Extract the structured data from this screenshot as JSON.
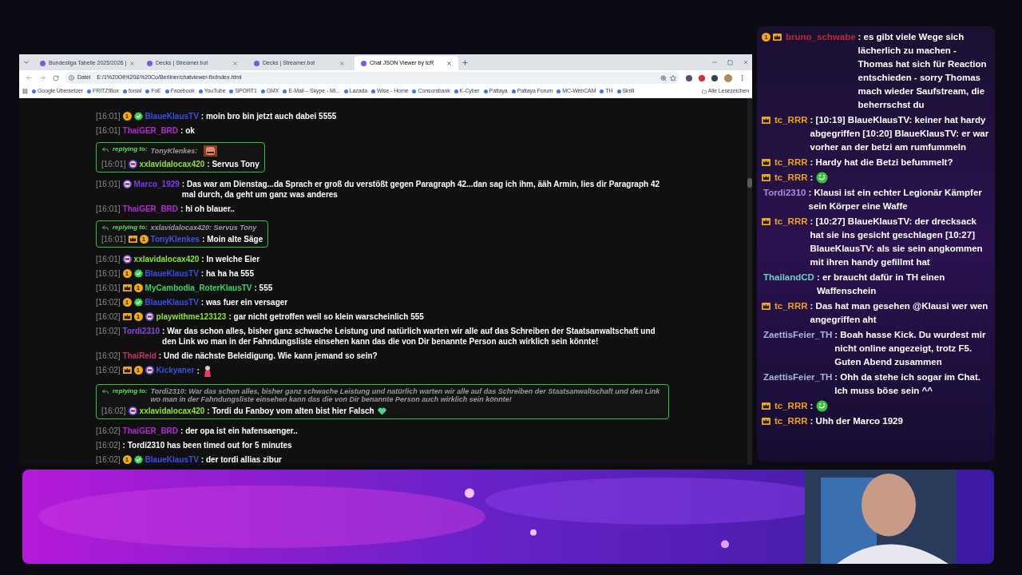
{
  "browser": {
    "tabs": [
      {
        "title": "Bundesliga Tabelle 2025/2026 |",
        "selected": false
      },
      {
        "title": "Decks | Streamer.bot",
        "selected": false
      },
      {
        "title": "Decks | Streamer.bot",
        "selected": false
      },
      {
        "title": "Chat JSON Viewer by tcR",
        "selected": true
      }
    ],
    "address": {
      "scheme": "Datei",
      "url": "E:/1%20Oli%20&%20Co/Berliner/chatviewer-fix/index.html"
    },
    "bookmarks": [
      "Google Übersetzer",
      "FRITZ!Box",
      "fonial",
      "FoE",
      "Facebook",
      "YouTube",
      "SPORT1",
      "GMX",
      "E-Mail – Skype - Mi...",
      "Lazada",
      "Wise - Home",
      "Consorsbank",
      "K-Cyber",
      "Pattaya",
      "Pattaya Forum",
      "MC-WebCAM",
      "TH",
      "Skrill"
    ],
    "all_bookmarks": "Alle Lesezeichen"
  },
  "chat": [
    {
      "time": "[16:01]",
      "badges": [
        {
          "kind": "sub",
          "label": "1"
        },
        {
          "kind": "verified"
        }
      ],
      "user": "BlaueKlausTV",
      "color": "#3d4ee8",
      "text": ": moin bro bin jetzt auch dabei 5555"
    },
    {
      "time": "[16:01]",
      "user": "ThaiGER_BRD",
      "color": "#b02bd0",
      "text": ": ok"
    },
    {
      "time": "[16:01]",
      "badges": [
        {
          "kind": "emblem"
        }
      ],
      "user": "xxlavidalocax420",
      "color": "#8fe03a",
      "text": ": Servus Tony",
      "reply": {
        "label": "replying to:",
        "text": "TonyKlenkes:",
        "emote": {
          "kind": "face"
        }
      }
    },
    {
      "time": "[16:01]",
      "badges": [
        {
          "kind": "emblem"
        }
      ],
      "user": "Marco_1929",
      "color": "#7b3df0",
      "text": ": Das war am Dienstag...da Sprach er groß du verstößt gegen Paragraph 42...dan sag ich ihm, ääh Armin, lies dir Paragraph 42 mal durch, da geht um ganz was anderes"
    },
    {
      "time": "[16:01]",
      "user": "ThaiGER_BRD",
      "color": "#b02bd0",
      "text": ": hi oh blauer.."
    },
    {
      "time": "[16:01]",
      "badges": [
        {
          "kind": "crown"
        },
        {
          "kind": "sub",
          "label": "1"
        }
      ],
      "user": "TonyKlenkes",
      "color": "#3d56e0",
      "text": ": Moin alte Säge",
      "reply": {
        "label": "replying to:",
        "text": "xxlavidalocax420: Servus Tony"
      }
    },
    {
      "time": "[16:01]",
      "badges": [
        {
          "kind": "emblem"
        }
      ],
      "user": "xxlavidalocax420",
      "color": "#8fe03a",
      "text": ": In welche Eier"
    },
    {
      "time": "[16:01]",
      "badges": [
        {
          "kind": "sub",
          "label": "1"
        },
        {
          "kind": "verified"
        }
      ],
      "user": "BlaueKlausTV",
      "color": "#3d4ee8",
      "text": ": ha ha ha 555"
    },
    {
      "time": "[16:01]",
      "badges": [
        {
          "kind": "crown"
        },
        {
          "kind": "sub",
          "label": "1"
        }
      ],
      "user": "MyCambodia_RoterKlausTV",
      "color": "#3ad46a",
      "text": ": 555"
    },
    {
      "time": "[16:02]",
      "badges": [
        {
          "kind": "sub",
          "label": "1"
        },
        {
          "kind": "verified"
        }
      ],
      "user": "BlaueKlausTV",
      "color": "#3d4ee8",
      "text": ": was fuer ein versager"
    },
    {
      "time": "[16:02]",
      "badges": [
        {
          "kind": "crown"
        },
        {
          "kind": "sub",
          "label": "1"
        },
        {
          "kind": "emblem"
        }
      ],
      "user": "playwithme123123",
      "color": "#8de040",
      "text": ": gar nicht getroffen weil so klein warscheinlich 555"
    },
    {
      "time": "[16:02]",
      "user": "Tordi2310",
      "color": "#8a4ad8",
      "text": ": War das schon alles, bisher ganz schwache Leistung und natürlich warten wir alle auf das Schreiben der Staatsanwaltschaft und den Link wo man in der Fahndungsliste einsehen kann das die von Dir benannte Person auch wirklich sein könnte!"
    },
    {
      "time": "[16:02]",
      "user": "ThaiReid",
      "color": "#c8306a",
      "text": ": Und die nächste Beleidigung. Wie kann jemand so sein?"
    },
    {
      "time": "[16:02]",
      "badges": [
        {
          "kind": "crown"
        },
        {
          "kind": "sub",
          "label": "1"
        },
        {
          "kind": "emblem"
        }
      ],
      "user": "Kickyaner",
      "color": "#3d4fe0",
      "text": ":",
      "emote": {
        "kind": "figure"
      }
    },
    {
      "time": "[16:02]",
      "badges": [
        {
          "kind": "emblem"
        }
      ],
      "user": "xxlavidalocax420",
      "color": "#8fe03a",
      "text": ": Tordi du Fanboy vom alten bist hier Falsch",
      "emote": {
        "kind": "heart"
      },
      "reply": {
        "label": "replying to:",
        "text": "Tordi2310: War das schon alles, bisher ganz schwache Leistung und natürlich warten wir alle auf das Schreiben der Staatsanwaltschaft und den Link wo man in der Fahndungsliste einsehen kann das die von Dir benannte Person auch wirklich sein könnte!"
      }
    },
    {
      "time": "[16:02]",
      "user": "ThaiGER_BRD",
      "color": "#b02bd0",
      "text": ": der opa ist ein hafensaenger.."
    },
    {
      "time": "[16:02]",
      "text": ": Tordi2310 has been timed out for 5 minutes"
    },
    {
      "time": "[16:02]",
      "badges": [
        {
          "kind": "sub",
          "label": "1"
        },
        {
          "kind": "verified"
        }
      ],
      "user": "BlaueKlausTV",
      "color": "#3d4ee8",
      "text": ": der tordi allias zibur"
    }
  ],
  "overlay_chat": [
    {
      "badges": [
        {
          "kind": "sub",
          "label": "1"
        },
        {
          "kind": "crown"
        }
      ],
      "user": "bruno_schwabe",
      "color": "#c0283a",
      "text": ": es gibt viele Wege sich lächerlich zu machen - Thomas hat sich für Reaction entschieden - sorry Thomas mach wieder Saufstream, die beherrschst du"
    },
    {
      "badges": [
        {
          "kind": "crown"
        }
      ],
      "user": "tc_RRR",
      "color": "#f0a020",
      "text": ": [10:19] BlaueKlausTV: keiner hat hardy abgegriffen [10:20] BlaueKlausTV: er war vorher an der betzi am rumfummeln"
    },
    {
      "badges": [
        {
          "kind": "crown"
        }
      ],
      "user": "tc_RRR",
      "color": "#f0a020",
      "text": ": Hardy hat die Betzi befummelt?"
    },
    {
      "badges": [
        {
          "kind": "crown"
        }
      ],
      "user": "tc_RRR",
      "color": "#f0a020",
      "text": ":",
      "emote": {
        "kind": "smiley"
      }
    },
    {
      "user": "Tordi2310",
      "color": "#b08ad8",
      "text": ": Klausi ist ein echter Legionär Kämpfer sein Körper eine Waffe"
    },
    {
      "badges": [
        {
          "kind": "crown"
        }
      ],
      "user": "tc_RRR",
      "color": "#f0a020",
      "text": ": [10:27] BlaueKlausTV: der drecksack hat sie ins gesicht geschlagen [10:27] BlaueKlausTV: als sie sein angkommen mit ihren handy gefillmt hat"
    },
    {
      "user": "ThailandCD",
      "color": "#6fd0c0",
      "text": ": er braucht dafür in TH einen Waffenschein"
    },
    {
      "badges": [
        {
          "kind": "crown"
        }
      ],
      "user": "tc_RRR",
      "color": "#f0a020",
      "text": ": Das hat man gesehen @Klausi wer wen angegriffen aht"
    },
    {
      "user": "ZaettisFeier_TH",
      "color": "#a8b8e0",
      "text": ": Boah hasse Kick. Du wurdest mir nicht online angezeigt, trotz F5. Guten Abend zusammen"
    },
    {
      "user": "ZaettisFeier_TH",
      "color": "#a8b8e0",
      "text": ": Ohh da stehe ich sogar im Chat. Ich muss böse sein ^^"
    },
    {
      "badges": [
        {
          "kind": "crown"
        }
      ],
      "user": "tc_RRR",
      "color": "#f0a020",
      "text": ":",
      "emote": {
        "kind": "smiley"
      }
    },
    {
      "badges": [
        {
          "kind": "crown"
        }
      ],
      "user": "tc_RRR",
      "color": "#f0a020",
      "text": ": Uhh der Marco 1929"
    }
  ]
}
